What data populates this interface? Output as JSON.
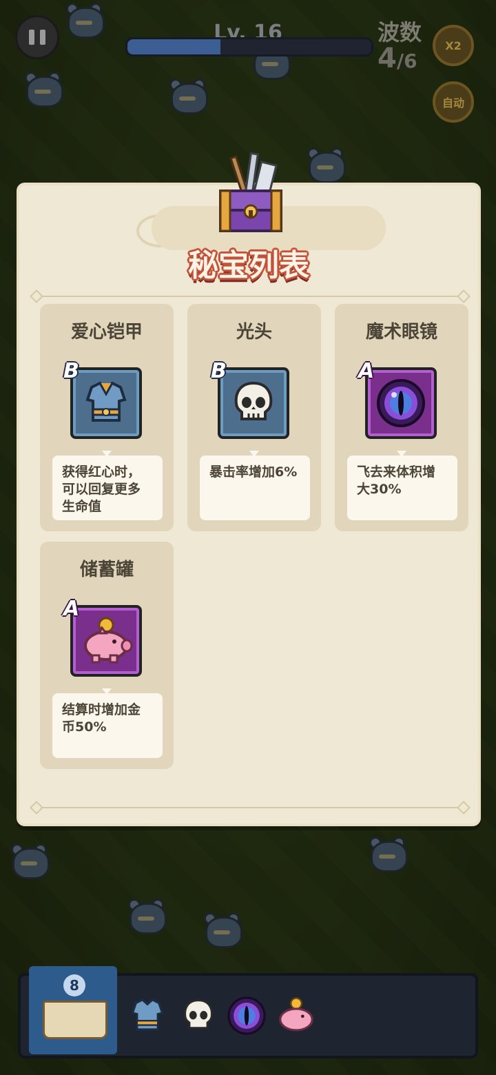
{
  "hud": {
    "level": "Lv. 16",
    "xp_progress": 0.38,
    "wave_label": "波数",
    "wave_current": "4",
    "wave_total": "/6",
    "speed_button": "X2",
    "auto_button": "自动"
  },
  "panel": {
    "title": "秘宝列表",
    "items": [
      {
        "name": "爱心铠甲",
        "rank": "B",
        "icon": "armor-icon",
        "desc": "获得红心时，可以回复更多生命值"
      },
      {
        "name": "光头",
        "rank": "B",
        "icon": "skull-icon",
        "desc": "暴击率增加6%"
      },
      {
        "name": "魔术眼镜",
        "rank": "A",
        "icon": "magic-eye-icon",
        "desc": "飞去来体积增大30%"
      },
      {
        "name": "储蓄罐",
        "rank": "A",
        "icon": "piggy-bank-icon",
        "desc": "结算时增加金币50%"
      }
    ]
  },
  "bottom_bar": {
    "book_count": "8",
    "slots": [
      "armor-icon",
      "skull-icon",
      "magic-eye-icon",
      "piggy-bank-icon"
    ]
  },
  "colors": {
    "rank_b": "#4d6f8d",
    "rank_a": "#7a2f8c",
    "title_outline": "#c2533b",
    "panel_bg": "#efe8d4"
  }
}
